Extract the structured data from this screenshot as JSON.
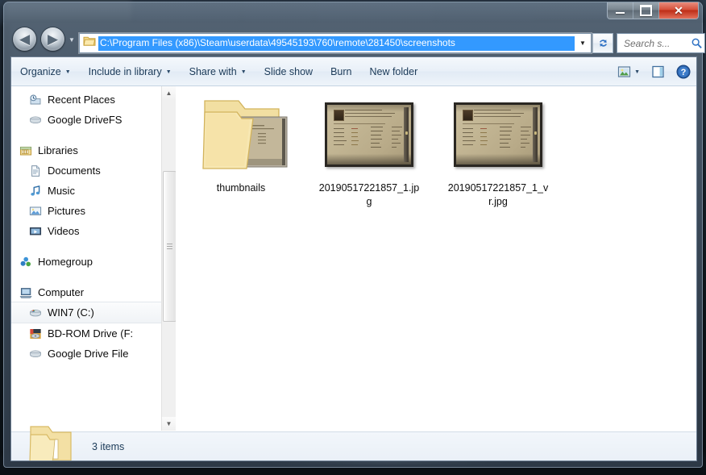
{
  "window": {
    "controls": {
      "minimize": "Minimize",
      "maximize": "Maximize",
      "close": "Close",
      "close_glyph": "✕"
    }
  },
  "navigation": {
    "back_label": "Back",
    "back_glyph": "◀",
    "forward_label": "Forward",
    "forward_glyph": "▶",
    "history_glyph": "▼",
    "address": {
      "path": "C:\\Program Files (x86)\\Steam\\userdata\\49545193\\760\\remote\\281450\\screenshots",
      "dropdown_glyph": "▼",
      "selected": true,
      "selection_color": "#3399ff"
    },
    "refresh_label": "Refresh",
    "search": {
      "placeholder": "Search s...",
      "value": ""
    }
  },
  "toolbar": {
    "items": [
      {
        "label": "Organize",
        "has_caret": true
      },
      {
        "label": "Include in library",
        "has_caret": true
      },
      {
        "label": "Share with",
        "has_caret": true
      },
      {
        "label": "Slide show",
        "has_caret": false
      },
      {
        "label": "Burn",
        "has_caret": false
      },
      {
        "label": "New folder",
        "has_caret": false
      }
    ],
    "caret_glyph": "▼",
    "view_button_label": "Change your view",
    "view_caret_glyph": "▼",
    "preview_pane_label": "Show the preview pane",
    "help_label": "Get help",
    "help_glyph": "?"
  },
  "sidebar": {
    "items": [
      {
        "label": "Recent Places",
        "icon": "recent-places-icon",
        "indent": true,
        "selected": false,
        "gap_before": false
      },
      {
        "label": "Google DriveFS",
        "icon": "drive-icon",
        "indent": true,
        "selected": false,
        "gap_before": false
      },
      {
        "label": "Libraries",
        "icon": "libraries-icon",
        "indent": false,
        "selected": false,
        "gap_before": true
      },
      {
        "label": "Documents",
        "icon": "documents-icon",
        "indent": true,
        "selected": false,
        "gap_before": false
      },
      {
        "label": "Music",
        "icon": "music-icon",
        "indent": true,
        "selected": false,
        "gap_before": false
      },
      {
        "label": "Pictures",
        "icon": "pictures-icon",
        "indent": true,
        "selected": false,
        "gap_before": false
      },
      {
        "label": "Videos",
        "icon": "videos-icon",
        "indent": true,
        "selected": false,
        "gap_before": false
      },
      {
        "label": "Homegroup",
        "icon": "homegroup-icon",
        "indent": false,
        "selected": false,
        "gap_before": true
      },
      {
        "label": "Computer",
        "icon": "computer-icon",
        "indent": false,
        "selected": false,
        "gap_before": true
      },
      {
        "label": "WIN7 (C:)",
        "icon": "hard-drive-icon",
        "indent": true,
        "selected": true,
        "gap_before": false
      },
      {
        "label": "BD-ROM Drive (F:",
        "icon": "optical-drive-icon",
        "indent": true,
        "selected": false,
        "gap_before": false
      },
      {
        "label": "Google Drive File",
        "icon": "drive-icon",
        "indent": true,
        "selected": false,
        "gap_before": false
      }
    ],
    "scrollbar": {
      "up_glyph": "▲",
      "down_glyph": "▼"
    }
  },
  "files": [
    {
      "name": "thumbnails",
      "type": "folder"
    },
    {
      "name": "20190517221857_1.jpg",
      "type": "image"
    },
    {
      "name": "20190517221857_1_vr.jpg",
      "type": "image"
    }
  ],
  "status": {
    "item_count_text": "3 items",
    "icon": "folder-icon"
  }
}
